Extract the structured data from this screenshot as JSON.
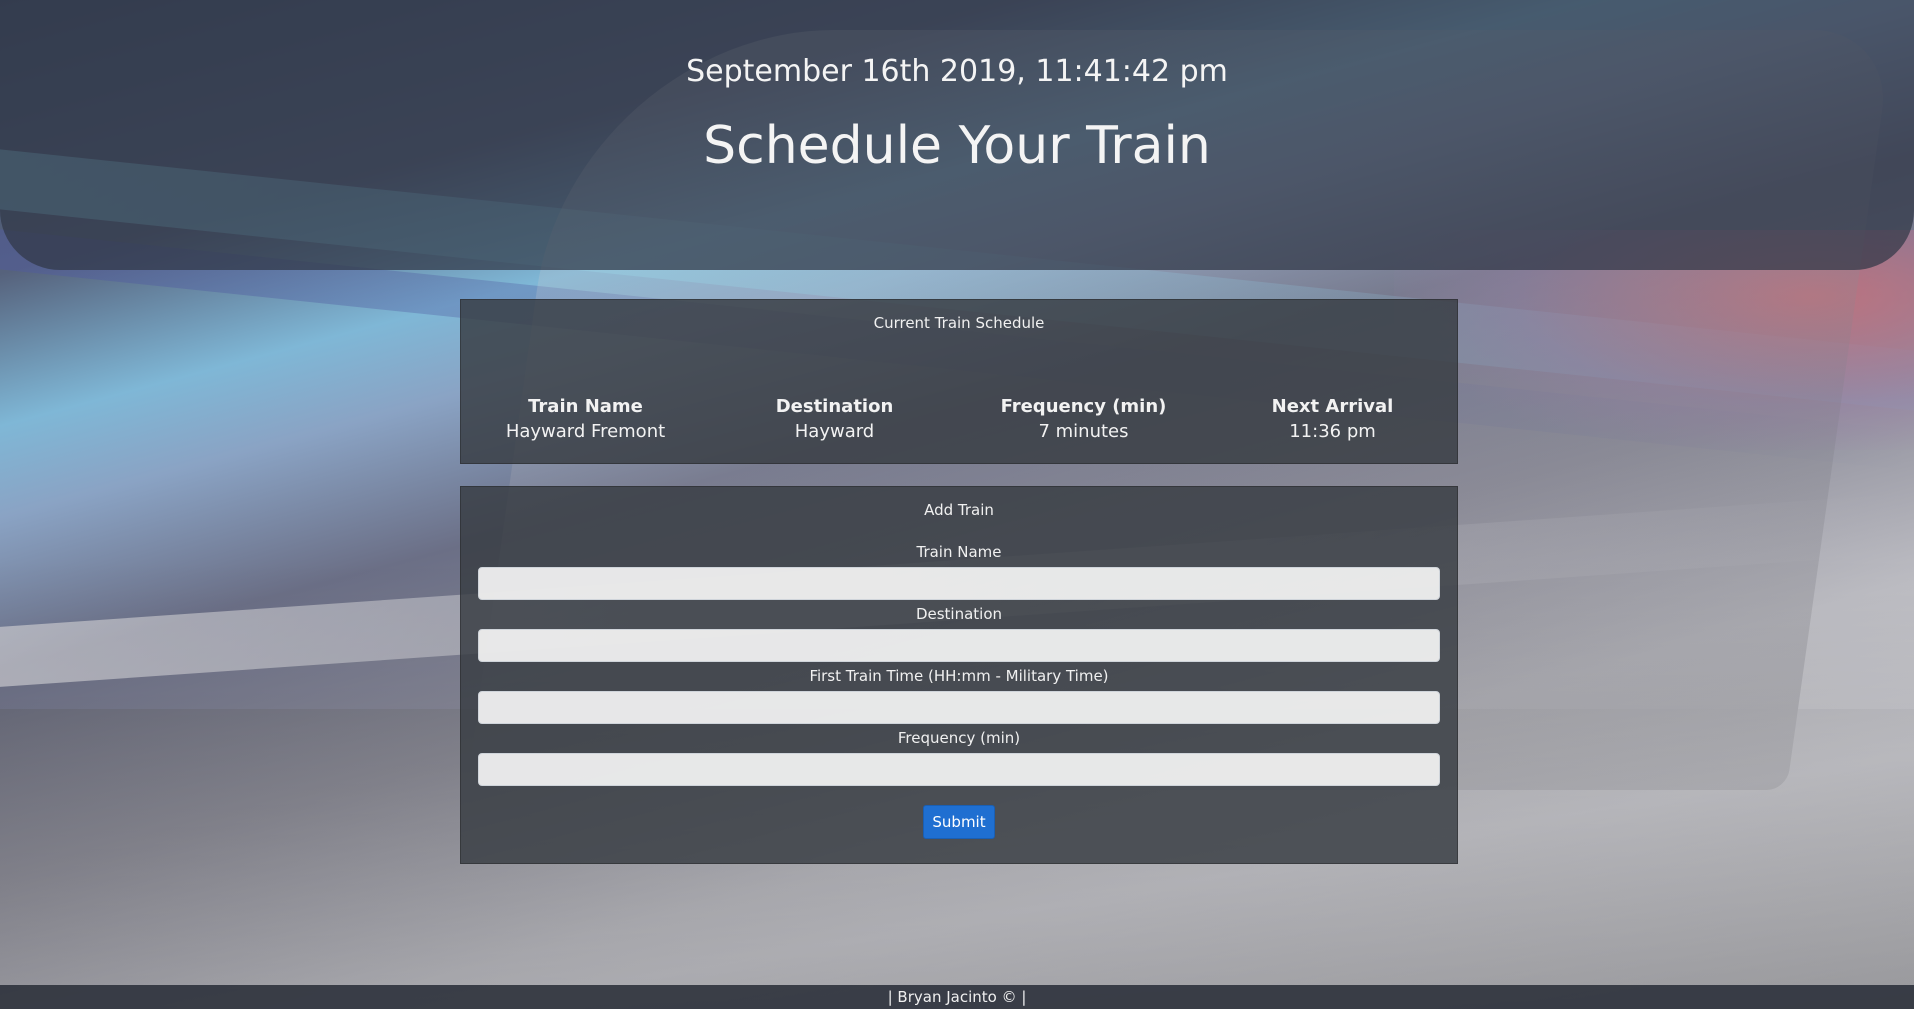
{
  "header": {
    "clock": "September 16th 2019, 11:41:42 pm",
    "title": "Schedule Your Train"
  },
  "schedule": {
    "heading": "Current Train Schedule",
    "columns": [
      "Train Name",
      "Destination",
      "Frequency (min)",
      "Next Arrival"
    ],
    "rows": [
      [
        "Hayward Fremont",
        "Hayward",
        "7 minutes",
        "11:36 pm"
      ]
    ]
  },
  "add_train": {
    "heading": "Add Train",
    "fields": [
      {
        "label": "Train Name",
        "value": "",
        "placeholder": ""
      },
      {
        "label": "Destination",
        "value": "",
        "placeholder": ""
      },
      {
        "label": "First Train Time (HH:mm - Military Time)",
        "value": "",
        "placeholder": ""
      },
      {
        "label": "Frequency (min)",
        "value": "",
        "placeholder": ""
      }
    ],
    "submit_label": "Submit"
  },
  "footer": {
    "text": "| Bryan Jacinto © |"
  },
  "colors": {
    "submit": "#1f6fd1",
    "panel": "#373c42",
    "header": "#303746"
  }
}
